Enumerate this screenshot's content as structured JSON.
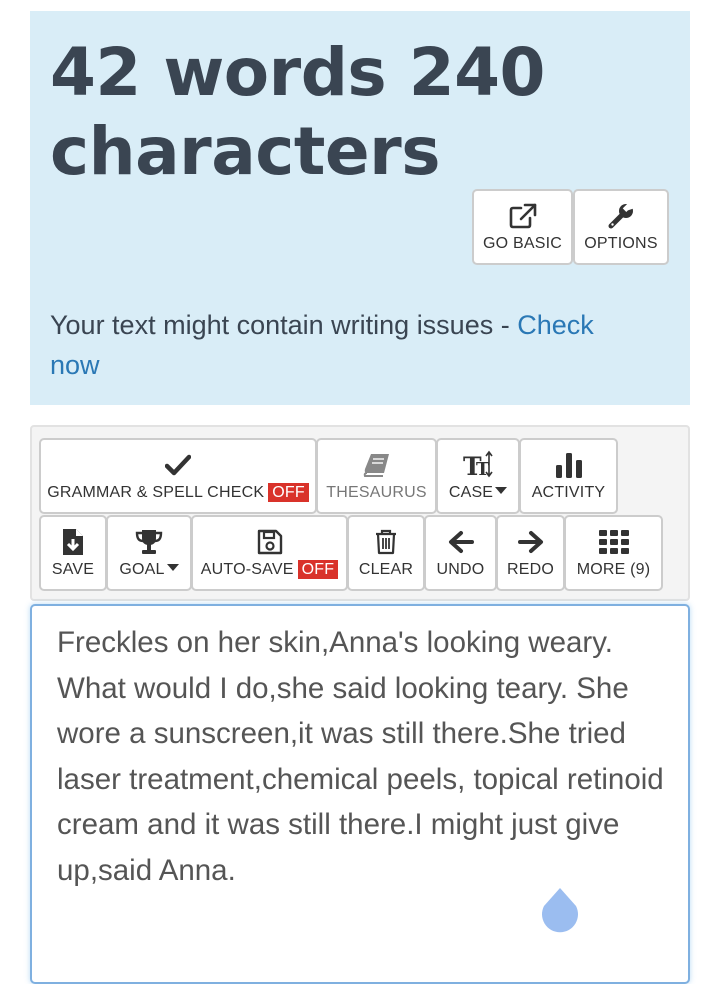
{
  "stats": {
    "count_text": "42 words 240 characters",
    "go_basic_label": "GO BASIC",
    "options_label": "OPTIONS",
    "issues_text": "Your text might contain writing issues - ",
    "check_now_label": "Check now"
  },
  "toolbar": {
    "grammar_label": "GRAMMAR & SPELL CHECK",
    "grammar_state": "OFF",
    "thesaurus_label": "THESAURUS",
    "case_label": "CASE",
    "activity_label": "ACTIVITY",
    "save_label": "SAVE",
    "goal_label": "GOAL",
    "autosave_label": "AUTO-SAVE",
    "autosave_state": "OFF",
    "clear_label": "CLEAR",
    "undo_label": "UNDO",
    "redo_label": "REDO",
    "more_label": "MORE (9)"
  },
  "editor": {
    "text": "Freckles on her skin,Anna's looking weary. What would I do,she said looking teary. She wore a sunscreen,it was still there.She tried laser treatment,chemical peels, topical retinoid cream and it was still there.I might just give up,said Anna."
  },
  "colors": {
    "panel_bg": "#d9edf7",
    "heading": "#3a4552",
    "link": "#2a78b5",
    "off_badge": "#d9322a",
    "editor_border": "#7fb0e0"
  },
  "icons": [
    "external-link-icon",
    "wrench-icon",
    "checkmark-icon",
    "book-icon",
    "text-case-icon",
    "bar-chart-icon",
    "file-download-icon",
    "trophy-icon",
    "floppy-disk-icon",
    "trash-icon",
    "arrow-left-icon",
    "arrow-right-icon",
    "grid-icon",
    "text-cursor-handle-icon"
  ]
}
